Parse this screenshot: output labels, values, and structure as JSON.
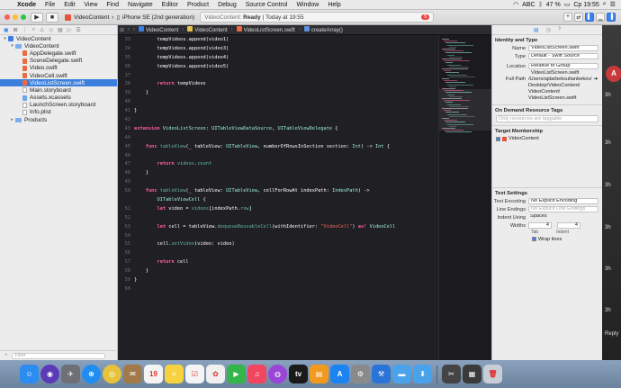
{
  "menubar": {
    "apple": "",
    "items": [
      "Xcode",
      "File",
      "Edit",
      "View",
      "Find",
      "Navigate",
      "Editor",
      "Product",
      "Debug",
      "Source Control",
      "Window",
      "Help"
    ],
    "status": {
      "keyboard": "ABC",
      "battery": "47 %",
      "clock": "Ср 19:55"
    }
  },
  "toolbar": {
    "scheme": "VideoContent",
    "device": "iPhone SE (2nd generation)",
    "activity_prefix": "VideoContent:",
    "activity_status": "Ready",
    "activity_time": "Today at 19:55",
    "error_count": "5"
  },
  "navigator": {
    "filter_placeholder": "Filter",
    "tree": [
      {
        "label": "VideoContent",
        "kind": "proj",
        "depth": 0,
        "disc": "▾"
      },
      {
        "label": "VideoContent",
        "kind": "folder",
        "depth": 1,
        "disc": "▾"
      },
      {
        "label": "AppDelegate.swift",
        "kind": "swift",
        "depth": 2
      },
      {
        "label": "SceneDelegate.swift",
        "kind": "swift",
        "depth": 2
      },
      {
        "label": "Video.swift",
        "kind": "swift",
        "depth": 2
      },
      {
        "label": "VideoCell.swift",
        "kind": "swift",
        "depth": 2
      },
      {
        "label": "VideoListScreen.swift",
        "kind": "swift",
        "depth": 2,
        "selected": true
      },
      {
        "label": "Main.storyboard",
        "kind": "plain",
        "depth": 2
      },
      {
        "label": "Assets.xcassets",
        "kind": "asset",
        "depth": 2
      },
      {
        "label": "LaunchScreen.storyboard",
        "kind": "plain",
        "depth": 2
      },
      {
        "label": "Info.plist",
        "kind": "plain",
        "depth": 2
      },
      {
        "label": "Products",
        "kind": "folder",
        "depth": 1,
        "disc": "▸"
      }
    ]
  },
  "jumpbar": {
    "crumbs": [
      "VideoContent",
      "VideoContent",
      "VideoListScreen.swift",
      "createArray()"
    ]
  },
  "code": {
    "lines": [
      {
        "n": "33",
        "t": [
          [
            "txt",
            "        tempVideos.append(video1)"
          ]
        ]
      },
      {
        "n": "34",
        "t": [
          [
            "txt",
            "        tempVideos.append(video3)"
          ]
        ]
      },
      {
        "n": "35",
        "t": [
          [
            "txt",
            "        tempVideos.append(video4)"
          ]
        ]
      },
      {
        "n": "36",
        "t": [
          [
            "txt",
            "        tempVideos.append(video5)"
          ]
        ]
      },
      {
        "n": "37",
        "t": [
          [
            "txt",
            ""
          ]
        ]
      },
      {
        "n": "38",
        "t": [
          [
            "kw",
            "        return"
          ],
          [
            "txt",
            " tempVideos"
          ]
        ]
      },
      {
        "n": "39",
        "t": [
          [
            "txt",
            "    }"
          ]
        ]
      },
      {
        "n": "40",
        "t": [
          [
            "txt",
            ""
          ]
        ]
      },
      {
        "n": "41",
        "t": [
          [
            "txt",
            "}"
          ]
        ]
      },
      {
        "n": "42",
        "t": [
          [
            "txt",
            ""
          ]
        ]
      },
      {
        "n": "43",
        "t": [
          [
            "kw",
            "extension"
          ],
          [
            "txt",
            " "
          ],
          [
            "ty",
            "VideoListScreen"
          ],
          [
            "txt",
            ": "
          ],
          [
            "ty",
            "UITableViewDataSource"
          ],
          [
            "txt",
            ", "
          ],
          [
            "ty",
            "UITableViewDelegate"
          ],
          [
            "txt",
            " {"
          ]
        ]
      },
      {
        "n": "44",
        "t": [
          [
            "txt",
            ""
          ]
        ]
      },
      {
        "n": "45",
        "t": [
          [
            "kw",
            "    func"
          ],
          [
            "txt",
            " "
          ],
          [
            "fn",
            "tableView"
          ],
          [
            "txt",
            "(_ tableView: "
          ],
          [
            "ty",
            "UITableView"
          ],
          [
            "txt",
            ", numberOfRowsInSection section: "
          ],
          [
            "ty",
            "Int"
          ],
          [
            "txt",
            ") -> "
          ],
          [
            "ty",
            "Int"
          ],
          [
            "txt",
            " {"
          ]
        ]
      },
      {
        "n": "46",
        "t": [
          [
            "txt",
            ""
          ]
        ]
      },
      {
        "n": "47",
        "t": [
          [
            "kw",
            "        return"
          ],
          [
            "txt",
            " "
          ],
          [
            "fn",
            "videos"
          ],
          [
            "txt",
            "."
          ],
          [
            "fn",
            "count"
          ]
        ]
      },
      {
        "n": "48",
        "t": [
          [
            "txt",
            "    }"
          ]
        ]
      },
      {
        "n": "49",
        "t": [
          [
            "txt",
            ""
          ]
        ]
      },
      {
        "n": "50",
        "t": [
          [
            "kw",
            "    func"
          ],
          [
            "txt",
            " "
          ],
          [
            "fn",
            "tableView"
          ],
          [
            "txt",
            "(_ tableView: "
          ],
          [
            "ty",
            "UITableView"
          ],
          [
            "txt",
            ", cellForRowAt indexPath: "
          ],
          [
            "ty",
            "IndexPath"
          ],
          [
            "txt",
            ") ->"
          ]
        ]
      },
      {
        "n": "",
        "t": [
          [
            "ty",
            "        UITableViewCell"
          ],
          [
            "txt",
            " {"
          ]
        ]
      },
      {
        "n": "51",
        "t": [
          [
            "kw",
            "        let"
          ],
          [
            "txt",
            " video = "
          ],
          [
            "fn",
            "videos"
          ],
          [
            "txt",
            "[indexPath."
          ],
          [
            "fn",
            "row"
          ],
          [
            "txt",
            "]"
          ]
        ]
      },
      {
        "n": "52",
        "t": [
          [
            "txt",
            ""
          ]
        ]
      },
      {
        "n": "53",
        "t": [
          [
            "kw",
            "        let"
          ],
          [
            "txt",
            " cell = tableView."
          ],
          [
            "fn",
            "dequeueReusableCell"
          ],
          [
            "txt",
            "(withIdentifier: "
          ],
          [
            "st",
            "\"VideoCell\""
          ],
          [
            "txt",
            ") "
          ],
          [
            "kw",
            "as!"
          ],
          [
            "txt",
            " "
          ],
          [
            "ty",
            "VideoCell"
          ]
        ]
      },
      {
        "n": "54",
        "t": [
          [
            "txt",
            ""
          ]
        ]
      },
      {
        "n": "55",
        "t": [
          [
            "txt",
            "        cell."
          ],
          [
            "fn",
            "setVideo"
          ],
          [
            "txt",
            "(video: video)"
          ]
        ]
      },
      {
        "n": "56",
        "t": [
          [
            "txt",
            ""
          ]
        ]
      },
      {
        "n": "57",
        "t": [
          [
            "kw",
            "        return"
          ],
          [
            "txt",
            " cell"
          ]
        ]
      },
      {
        "n": "58",
        "t": [
          [
            "txt",
            "    }"
          ]
        ]
      },
      {
        "n": "59",
        "t": [
          [
            "txt",
            "}"
          ]
        ]
      },
      {
        "n": "60",
        "t": [
          [
            "txt",
            ""
          ]
        ]
      }
    ]
  },
  "inspector": {
    "identity_header": "Identity and Type",
    "name_label": "Name",
    "name_value": "VideoListScreen.swift",
    "type_label": "Type",
    "type_value": "Default - Swift Source",
    "location_label": "Location",
    "location_value": "Relative to Group",
    "location_file": "VideoListScreen.swift",
    "fullpath_label": "Full Path",
    "fullpath_lines": [
      "/Users/ajdarbeksultanbekov/",
      "Desktop/VideoContent/",
      "VideoContent/",
      "VideoListScreen.swift"
    ],
    "odr_header": "On Demand Resource Tags",
    "odr_placeholder": "Only resources are taggable",
    "membership_header": "Target Membership",
    "membership_target": "VideoContent",
    "text_header": "Text Settings",
    "encoding_label": "Text Encoding",
    "encoding_value": "No Explicit Encoding",
    "endings_label": "Line Endings",
    "endings_value": "No Explicit Line Endings",
    "indent_label": "Indent Using",
    "indent_value": "Spaces",
    "widths_label": "Widths",
    "tab_value": "4",
    "indent_width_value": "4",
    "tab_caption": "Tab",
    "indent_caption": "Indent",
    "wrap_label": "Wrap lines"
  },
  "desktop": {
    "avatar_letter": "A",
    "texts": [
      "3h",
      "3h",
      "3h",
      "3h",
      "3h",
      "3h",
      "Reply"
    ]
  },
  "dock": {
    "apps": [
      {
        "name": "finder-icon",
        "glyph": "☺",
        "bg": "#2d8cf0"
      },
      {
        "name": "siri-icon",
        "glyph": "◉",
        "bg": "#5b3ab8"
      },
      {
        "name": "launchpad-icon",
        "glyph": "✈",
        "bg": "#6f6f78"
      },
      {
        "name": "safari-icon",
        "glyph": "⊕",
        "bg": "#1f8ef0"
      },
      {
        "name": "chrome-icon",
        "glyph": "◎",
        "bg": "#e8c23a"
      },
      {
        "name": "notes-box-icon",
        "glyph": "✉",
        "bg": "#a27a4a"
      },
      {
        "name": "calendar-icon",
        "glyph": "19",
        "bg": "#f4f4f4"
      },
      {
        "name": "notes-icon",
        "glyph": "≡",
        "bg": "#f6d23e"
      },
      {
        "name": "reminders-icon",
        "glyph": "☑",
        "bg": "#f4f4f4"
      },
      {
        "name": "photos-icon",
        "glyph": "✿",
        "bg": "#f0f0f0"
      },
      {
        "name": "facetime-icon",
        "glyph": "▶",
        "bg": "#33b54a"
      },
      {
        "name": "music-icon",
        "glyph": "♫",
        "bg": "#f2455f"
      },
      {
        "name": "podcasts-icon",
        "glyph": "◍",
        "bg": "#9a45d8"
      },
      {
        "name": "tv-icon",
        "glyph": "tv",
        "bg": "#1a1a1a"
      },
      {
        "name": "books-icon",
        "glyph": "▤",
        "bg": "#f29a1e"
      },
      {
        "name": "app-store-icon",
        "glyph": "A",
        "bg": "#1b84f2"
      },
      {
        "name": "system-preferences-icon",
        "glyph": "⚙",
        "bg": "#8a8a8a"
      },
      {
        "name": "xcode-icon",
        "glyph": "⚒",
        "bg": "#2a74d8"
      },
      {
        "name": "folder-icon",
        "glyph": "▬",
        "bg": "#4aa2ea"
      },
      {
        "name": "downloads-icon",
        "glyph": "⬇",
        "bg": "#4aa2ea"
      },
      {
        "name": "screenshot-icon",
        "glyph": "✂",
        "bg": "#444"
      },
      {
        "name": "preview-icon",
        "glyph": "▦",
        "bg": "#3a3a3a"
      },
      {
        "name": "trash-icon",
        "glyph": "🗑",
        "bg": "#c9ced6"
      }
    ]
  }
}
